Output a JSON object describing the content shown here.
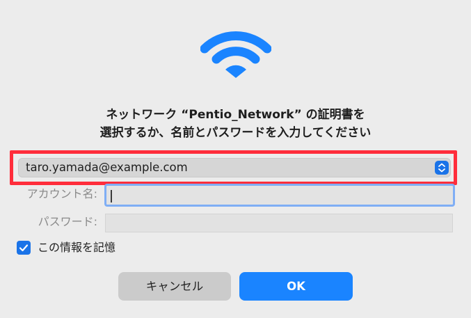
{
  "dialog": {
    "title_line1": "ネットワーク “Pentio_Network” の証明書を",
    "title_line2": "選択するか、名前とパスワードを入力してください",
    "icon": "wifi-icon"
  },
  "certificate_popup": {
    "selected": "taro.yamada@example.com",
    "highlight_color": "#ff2d3b"
  },
  "fields": {
    "account_label": "アカウント名:",
    "account_value": "",
    "password_label": "パスワード:",
    "password_value": ""
  },
  "remember": {
    "label": "この情報を記憶",
    "checked": true
  },
  "buttons": {
    "cancel": "キャンセル",
    "ok": "OK"
  },
  "colors": {
    "accent": "#1a84ff",
    "wifi": "#1a84ff"
  }
}
